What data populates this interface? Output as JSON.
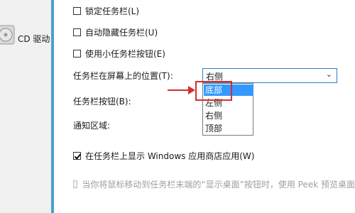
{
  "sidebar": {
    "drive_label": "CD 驱动"
  },
  "taskbar": {
    "lock_label": "锁定任务栏(L)",
    "autohide_label": "自动隐藏任务栏(U)",
    "small_buttons_label": "使用小任务栏按钮(E)",
    "position_label": "任务栏在屏幕上的位置(T):",
    "position_value": "右侧",
    "position_options": [
      "底部",
      "左侧",
      "右侧",
      "顶部"
    ],
    "position_selected_index": 0,
    "buttons_label": "任务栏按钮(B):",
    "notify_label": "通知区域:",
    "store_apps_label": "在任务栏上显示 Windows 应用商店应用(W)",
    "peek_label": "当你将鼠标移动到任务栏末端的“显示桌面”按钮时，使用 Peek 预览桌面"
  },
  "colors": {
    "accent": "#2f7fc7",
    "selection": "#3399ff",
    "annotation": "#d32f2f"
  }
}
